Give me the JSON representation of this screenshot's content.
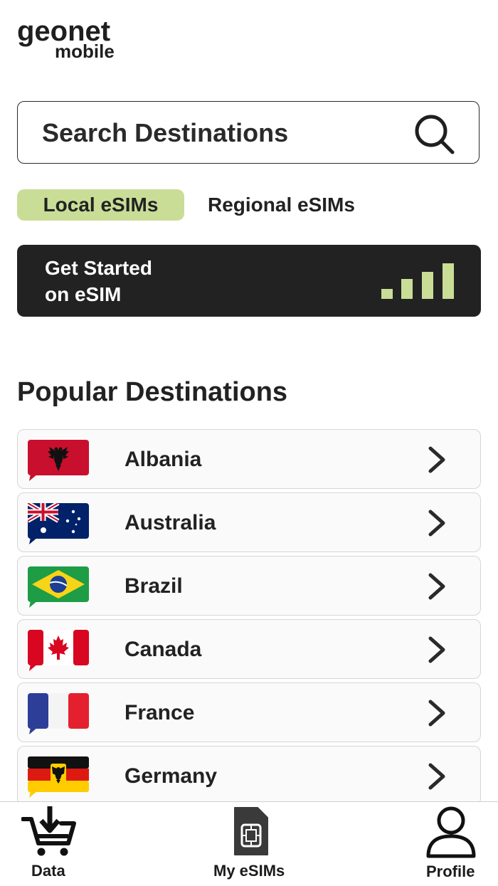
{
  "brand": {
    "line1": "geonet",
    "line2": "mobile"
  },
  "search": {
    "placeholder": "Search Destinations",
    "icon": "search-icon"
  },
  "tabs": [
    {
      "label": "Local eSIMs",
      "active": true
    },
    {
      "label": "Regional eSIMs",
      "active": false
    }
  ],
  "banner": {
    "line1": "Get Started",
    "line2": "on eSIM",
    "icon": "signal-bars-icon"
  },
  "popular": {
    "title": "Popular Destinations",
    "items": [
      {
        "name": "Albania",
        "flag": "albania-flag-icon"
      },
      {
        "name": "Australia",
        "flag": "australia-flag-icon"
      },
      {
        "name": "Brazil",
        "flag": "brazil-flag-icon"
      },
      {
        "name": "Canada",
        "flag": "canada-flag-icon"
      },
      {
        "name": "France",
        "flag": "france-flag-icon"
      },
      {
        "name": "Germany",
        "flag": "germany-flag-icon"
      }
    ]
  },
  "nav": [
    {
      "label": "Data",
      "icon": "cart-download-icon"
    },
    {
      "label": "My eSIMs",
      "icon": "sim-card-icon"
    },
    {
      "label": "Profile",
      "icon": "user-icon"
    }
  ],
  "colors": {
    "accent": "#c9dd97",
    "dark": "#222222",
    "border": "#d6d6d6"
  }
}
